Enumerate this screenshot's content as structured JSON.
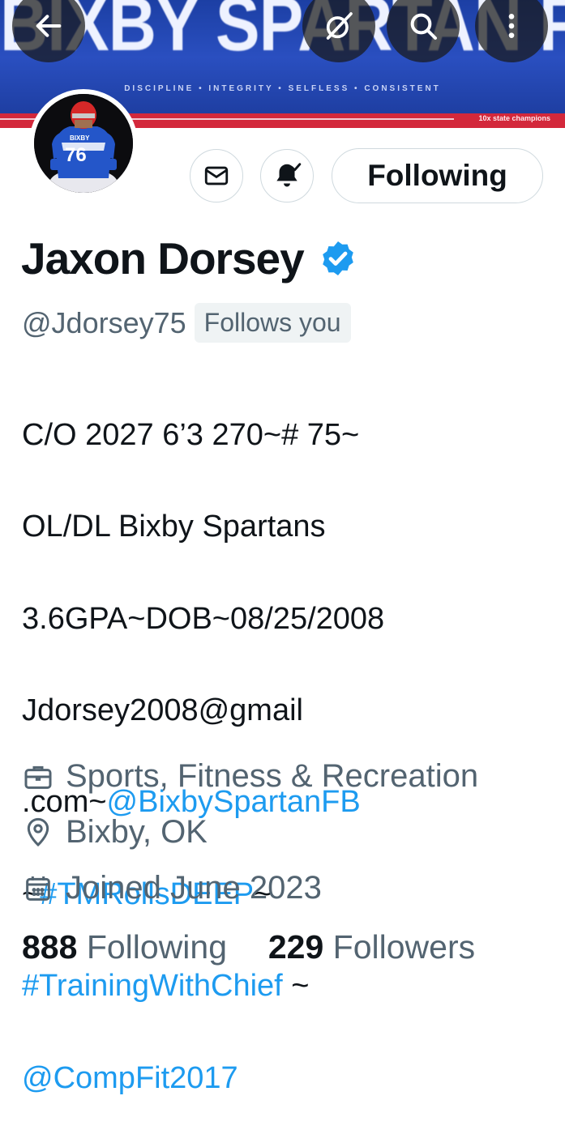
{
  "banner": {
    "title": "BIXBY SPARTAN FOOTBALL",
    "motto": "DISCIPLINE • INTEGRITY • SELFLESS • CONSISTENT",
    "champions": "10x state champions"
  },
  "avatar": {
    "jersey_number": "76",
    "jersey_text": "BIXBY"
  },
  "actions": {
    "following_label": "Following"
  },
  "profile": {
    "name": "Jaxon Dorsey",
    "handle": "@Jdorsey75",
    "follows_you": "Follows you"
  },
  "bio": {
    "line1": "C/O 2027 6’3 270~# 75~",
    "line2": "OL/DL Bixby Spartans",
    "line3": "3.6GPA~DOB~08/25/2008",
    "line4": "Jdorsey2008@gmail",
    "line5_prefix": ".com~",
    "mention1": "@BixbySpartanFB",
    "line6_prefix": "~",
    "hashtag1": "#TMRollsDEEP",
    "line6_suffix": "~",
    "hashtag2": "#TrainingWithChief",
    "line7_suffix": " ~",
    "mention2": "@CompFit2017"
  },
  "meta": {
    "category": "Sports, Fitness & Recreation",
    "location": "Bixby, OK",
    "joined": "Joined June 2023"
  },
  "stats": {
    "following_count": "888",
    "following_label": "Following",
    "followers_count": "229",
    "followers_label": "Followers"
  },
  "colors": {
    "link": "#1d9bf0",
    "verified": "#1d9bf0",
    "secondary": "#536471"
  }
}
